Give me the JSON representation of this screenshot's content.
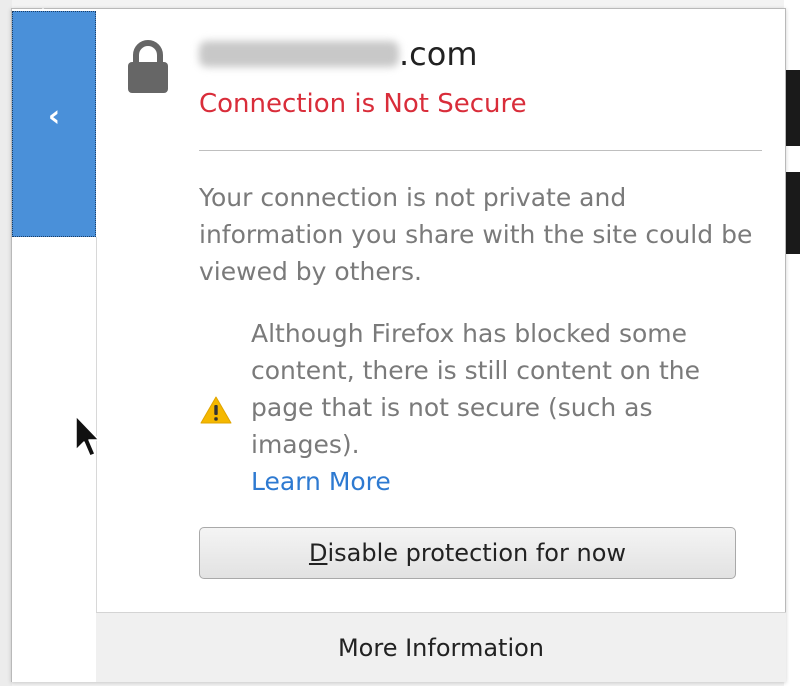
{
  "identity": {
    "host_suffix": ".com",
    "status_title": "Connection is Not Secure"
  },
  "description": "Your connection is not private and information you share with the site could be viewed by others.",
  "mixed_content": {
    "text": "Although Firefox has blocked some content, there is still content on the page that is not secure (such as images).",
    "learn_more": "Learn More"
  },
  "actions": {
    "disable_underlined": "D",
    "disable_rest": "isable protection for now",
    "more_information": "More Information"
  },
  "icons": {
    "back": "chevron-left-icon",
    "lock": "lock-icon",
    "warning": "warning-icon",
    "cursor": "mouse-pointer-icon"
  },
  "colors": {
    "accent_blue": "#4a90d9",
    "insecure_red": "#d92d3a",
    "link_blue": "#2e7ad1",
    "warning_yellow": "#f5b800"
  }
}
